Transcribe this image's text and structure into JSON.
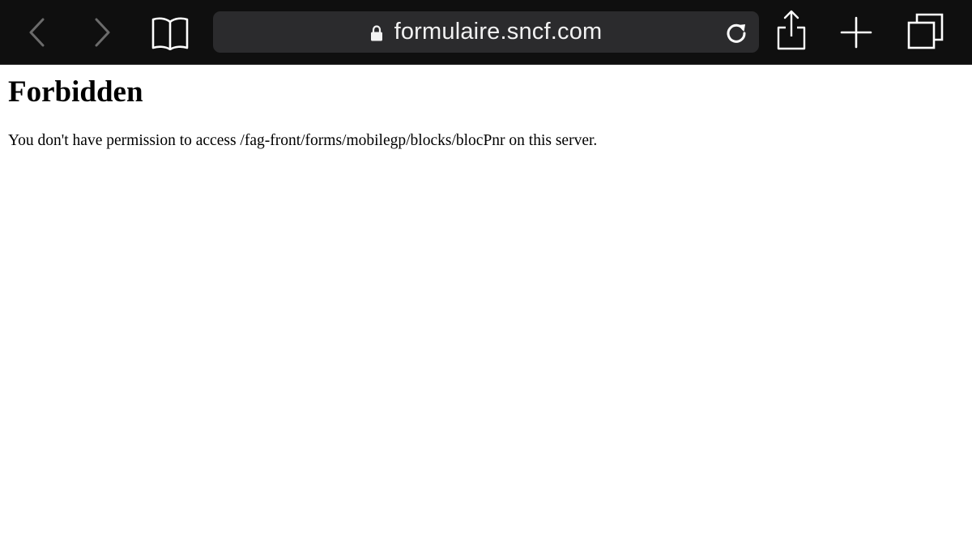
{
  "browser": {
    "url_display": "formulaire.sncf.com",
    "toolbar_icons": [
      "back-arrow-icon",
      "forward-arrow-icon",
      "bookmarks-icon",
      "lock-icon",
      "reload-icon",
      "share-icon",
      "new-tab-icon",
      "tabs-icon"
    ],
    "colors": {
      "toolbar_bg": "#0f0f0f",
      "url_bar_bg": "#2b2b2d",
      "icon_active": "#ffffff",
      "icon_disabled": "#6b6b6b"
    }
  },
  "content": {
    "heading": "Forbidden",
    "message": "You don't have permission to access /fag-front/forms/mobilegp/blocks/blocPnr on this server."
  }
}
